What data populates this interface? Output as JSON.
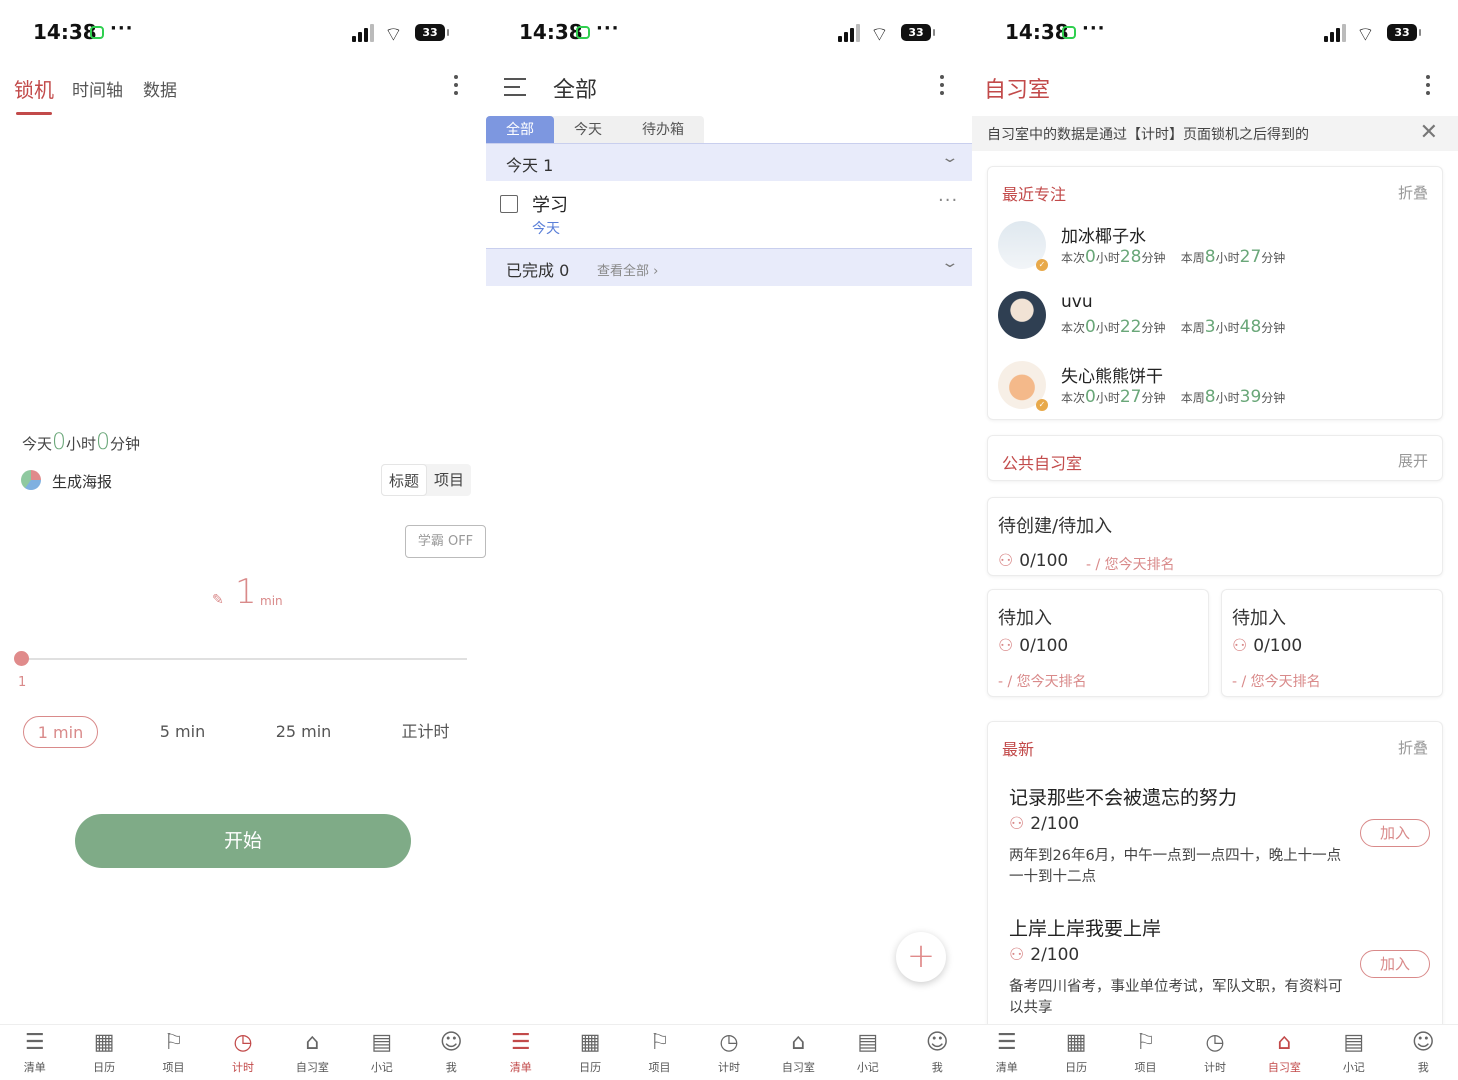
{
  "status_bar": {
    "time": "14:38",
    "dots": "···",
    "battery": "33"
  },
  "bottom_nav": [
    {
      "label": "清单",
      "icon": "list-icon",
      "glyph": "☰"
    },
    {
      "label": "日历",
      "icon": "calendar-icon",
      "glyph": "📅"
    },
    {
      "label": "项目",
      "icon": "project-icon",
      "glyph": "⚐"
    },
    {
      "label": "计时",
      "icon": "timer-icon",
      "glyph": "⏱"
    },
    {
      "label": "自习室",
      "icon": "study-room-icon",
      "glyph": "⌂"
    },
    {
      "label": "小记",
      "icon": "notebook-icon",
      "glyph": "▤"
    },
    {
      "label": "我",
      "icon": "profile-icon",
      "glyph": "☺"
    }
  ],
  "screen1": {
    "tabs": [
      "锁机",
      "时间轴",
      "数据"
    ],
    "active_tab": "锁机",
    "today_prefix": "今天",
    "today_h": "0",
    "hour_unit": "小时",
    "today_m": "0",
    "min_unit": "分钟",
    "poster_label": "生成海报",
    "seg": [
      "标题",
      "项目"
    ],
    "xueba": "学霸 OFF",
    "duration_value": "1",
    "duration_unit": "min",
    "slider_value": "1",
    "presets": [
      "1 min",
      "5 min",
      "25 min",
      "正计时"
    ],
    "start_label": "开始",
    "active_nav": "计时"
  },
  "screen2": {
    "title": "全部",
    "filter_tabs": [
      "全部",
      "今天",
      "待办箱"
    ],
    "group_today": "今天  1",
    "task_title": "学习",
    "task_date": "今天",
    "task_more": "···",
    "done_label": "已完成  0",
    "view_all": "查看全部 ›",
    "fab": "+",
    "active_nav": "清单"
  },
  "screen3": {
    "title": "自习室",
    "banner": "自习室中的数据是通过【计时】页面锁机之后得到的",
    "recent": {
      "title": "最近专注",
      "action": "折叠",
      "users": [
        {
          "name": "加冰椰子水",
          "cur_h": "0",
          "cur_m": "28",
          "week_h": "8",
          "week_m": "27"
        },
        {
          "name": "uvu",
          "cur_h": "0",
          "cur_m": "22",
          "week_h": "3",
          "week_m": "48"
        },
        {
          "name": "失心熊熊饼干",
          "cur_h": "0",
          "cur_m": "27",
          "week_h": "8",
          "week_m": "39"
        }
      ],
      "cur_label": "本次",
      "week_label": "本周",
      "h_unit": "小时",
      "m_unit": "分钟"
    },
    "public": {
      "title": "公共自习室",
      "action": "展开"
    },
    "rooms": [
      {
        "title": "待创建/待加入",
        "count": "0/100",
        "rank": "- / 您今天排名"
      },
      {
        "title": "待加入",
        "count": "0/100",
        "rank": "- / 您今天排名"
      },
      {
        "title": "待加入",
        "count": "0/100",
        "rank": "- / 您今天排名"
      }
    ],
    "latest": {
      "title": "最新",
      "action": "折叠",
      "items": [
        {
          "title": "记录那些不会被遗忘的努力",
          "count": "2/100",
          "desc": "两年到26年6月，中午一点到一点四十，晚上十一点一十到十二点",
          "join": "加入"
        },
        {
          "title": "上岸上岸我要上岸",
          "count": "2/100",
          "desc": "备考四川省考，事业单位考试，军队文职，有资料可以共享",
          "join": "加入"
        }
      ]
    },
    "active_nav": "自习室"
  },
  "colors": {
    "accent": "#c24a4a",
    "green": "#7fab87",
    "blue": "#7d97e0",
    "pink": "#d98a8a"
  }
}
